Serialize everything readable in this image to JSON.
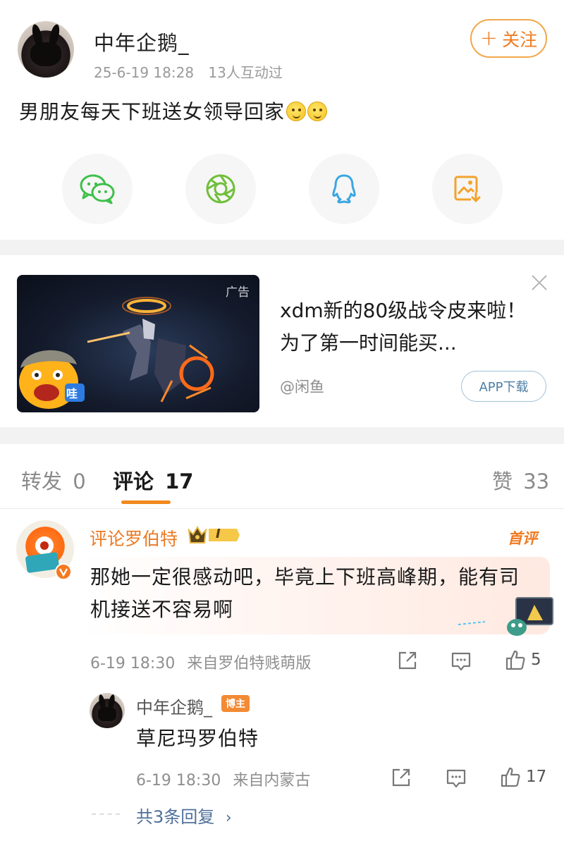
{
  "post": {
    "username": "中年企鹅_",
    "date": "25-6-19 18:28",
    "interactions": "13人互动过",
    "follow_label": "关注",
    "text": "男朋友每天下班送女领导回家",
    "emoji_icons": [
      "smiling-emoji-icon",
      "smiling-emoji-icon"
    ]
  },
  "share": [
    {
      "name": "wechat-icon",
      "color": "#3fbf4a"
    },
    {
      "name": "moments-icon",
      "color": "#6fbf3a"
    },
    {
      "name": "qq-icon",
      "color": "#3aa6e0"
    },
    {
      "name": "save-image-icon",
      "color": "#f3a32c"
    }
  ],
  "ad": {
    "tag": "广告",
    "title": "xdm新的80级战令皮来啦！为了第一时间能买...",
    "source": "@闲鱼",
    "app_button": "APP下载",
    "mascot_text": "哇"
  },
  "tabs": {
    "repost_label": "转发",
    "repost_count": "0",
    "comments_label": "评论",
    "comments_count": "17",
    "likes_label": "赞",
    "likes_count": "33"
  },
  "comment": {
    "username": "评论罗伯特",
    "level_badge": "I",
    "first_badge": "首评",
    "text": "那她一定很感动吧，毕竟上下班高峰期，能有司机接送不容易啊",
    "time": "6-19 18:30",
    "source": "来自罗伯特贱萌版",
    "likes": "5"
  },
  "reply": {
    "username": "中年企鹅_",
    "host_badge": "博主",
    "text": "草尼玛罗伯特",
    "time": "6-19 18:30",
    "source": "来自内蒙古",
    "likes": "17",
    "more_replies": "共3条回复"
  },
  "colors": {
    "accent": "#f28a1e",
    "link": "#4f6f9a",
    "gap": "#f2f2f2"
  }
}
